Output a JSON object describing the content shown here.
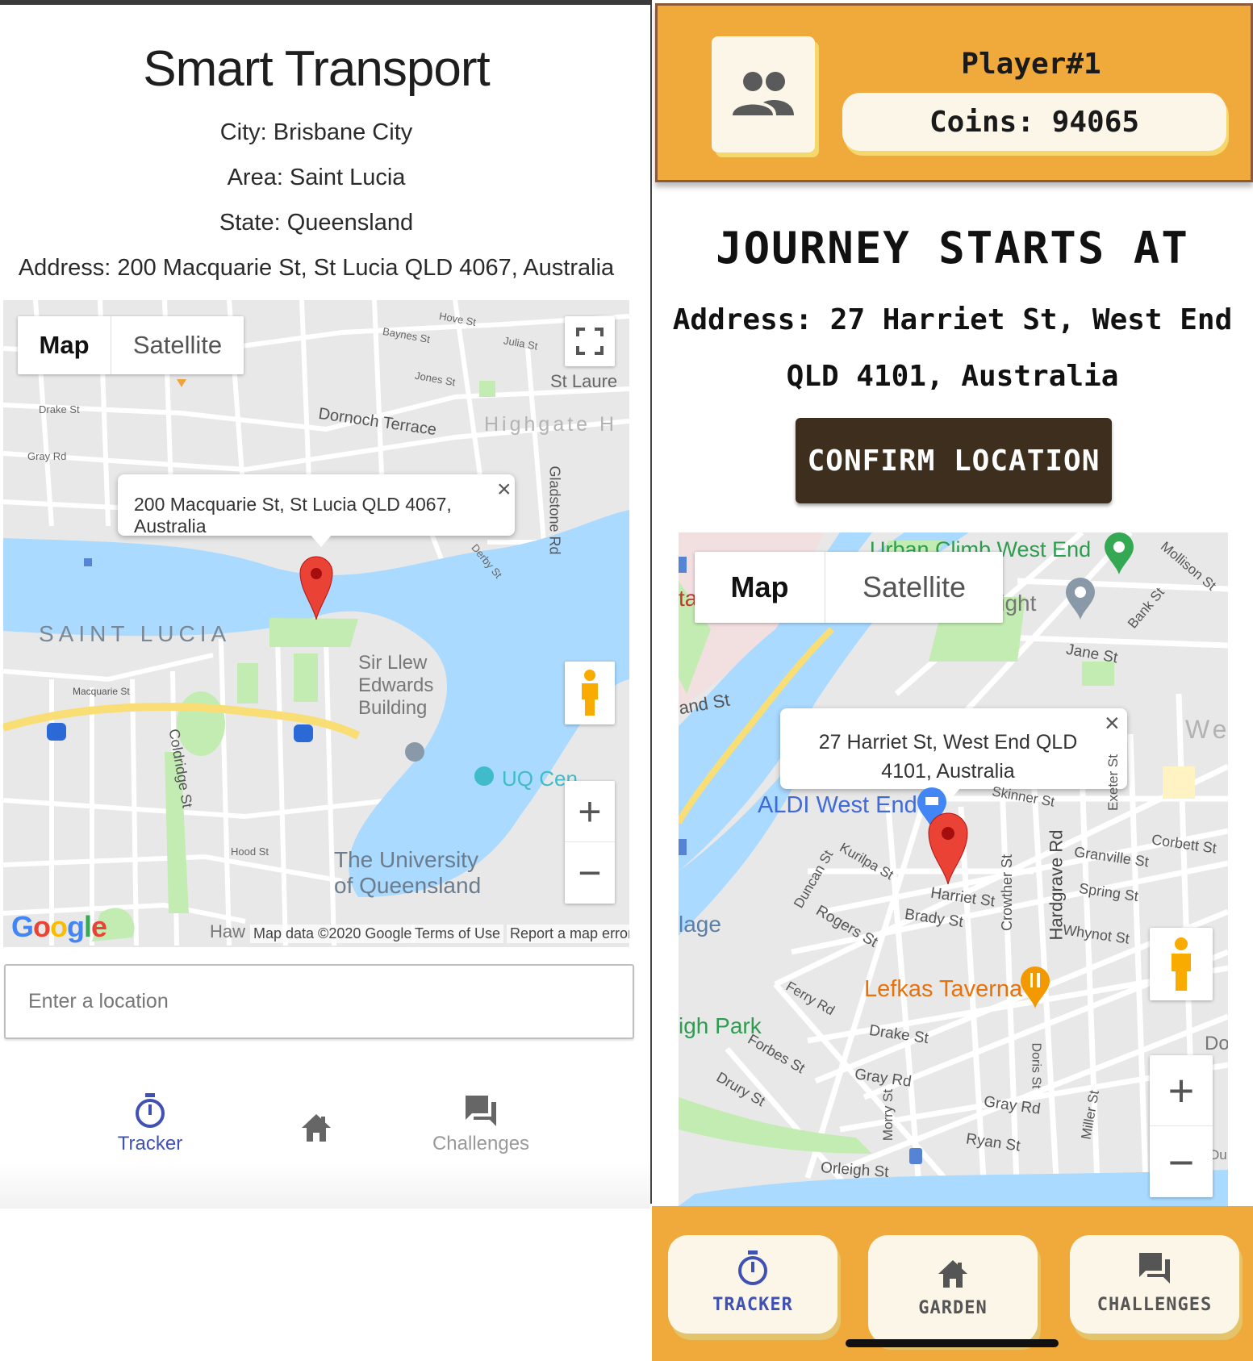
{
  "left": {
    "title": "Smart Transport",
    "city": "City: Brisbane City",
    "area": "Area: Saint Lucia",
    "state": "State: Queensland",
    "address": "Address: 200 Macquarie St, St Lucia QLD 4067, Australia",
    "map": {
      "type_map": "Map",
      "type_satellite": "Satellite",
      "infowindow": "200 Macquarie St, St Lucia QLD 4067, Australia",
      "close_glyph": "×",
      "labels": {
        "saint_lucia": "SAINT LUCIA",
        "highgate": "Highgate H",
        "st_laure": "St Laure",
        "dornoch": "Dornoch Terrace",
        "sir_llew_1": "Sir Llew",
        "sir_llew_2": "Edwards",
        "sir_llew_3": "Building",
        "uq_cen": "UQ Cen",
        "uq_1": "The University",
        "uq_2": "of Queensland",
        "gladstone": "Gladstone Rd",
        "coldridge": "Coldridge St",
        "macquarie": "Macquarie St",
        "hood": "Hood St",
        "drake": "Drake St",
        "gray": "Gray Rd",
        "jones": "Jones St",
        "baynes": "Baynes St",
        "hove": "Hove St",
        "julia": "Julia St",
        "derby": "Derby St",
        "haw": "Haw"
      },
      "google": "Google",
      "attribution": "Map data ©2020 Google",
      "terms": "Terms of Use",
      "report": "Report a map error",
      "zoom_in": "+",
      "zoom_out": "−"
    },
    "search_placeholder": "Enter a location",
    "nav": {
      "tracker": "Tracker",
      "challenges": "Challenges"
    }
  },
  "right": {
    "player": "Player#1",
    "coins": "Coins: 94065",
    "heading": "JOURNEY STARTS AT",
    "address_line1": "Address: 27 Harriet St, West End",
    "address_line2": "QLD 4101, Australia",
    "confirm": "CONFIRM LOCATION",
    "map": {
      "type_map": "Map",
      "type_satellite": "Satellite",
      "infowindow_line1": "27 Harriet St, West End QLD",
      "infowindow_line2": "4101, Australia",
      "close_glyph": "×",
      "labels": {
        "urban_climb": "Urban Climb West End",
        "light": "light",
        "jane": "Jane St",
        "aldi": "ALDI West End",
        "lefkas": "Lefkas Taverna",
        "park": "igh Park",
        "lage": "lage",
        "ta": "ta",
        "and_st": "and St",
        "we": "We",
        "do": "Do",
        "du": "Du",
        "skinner": "Skinner St",
        "kurilpa": "Kurilpa St",
        "harriet": "Harriet St",
        "brady": "Brady St",
        "rogers": "Rogers St",
        "duncan": "Duncan St",
        "crowther": "Crowther St",
        "hardgrave": "Hardgrave Rd",
        "granville": "Granville St",
        "spring": "Spring St",
        "whynot": "Whynot St",
        "corbett": "Corbett St",
        "exeter": "Exeter St",
        "ferry": "Ferry Rd",
        "drake": "Drake St",
        "forbes": "Forbes St",
        "drury": "Drury St",
        "gray": "Gray Rd",
        "gray2": "Gray Rd",
        "doris": "Doris St",
        "morry": "Morry St",
        "ryan": "Ryan St",
        "orleigh": "Orleigh St",
        "miller": "Miller St",
        "mollison": "Mollison St",
        "bank": "Bank St"
      },
      "zoom_in": "+",
      "zoom_out": "−"
    },
    "nav": {
      "tracker": "TRACKER",
      "garden": "GARDEN",
      "challenges": "CHALLENGES"
    }
  },
  "colors": {
    "orange": "#f0a93b",
    "cream": "#fbf6e8",
    "dark_brown": "#3d2e1d",
    "nav_blue": "#3f51b5",
    "water": "#aadaff",
    "park": "#c3ecb2",
    "marker": "#ea4335"
  }
}
